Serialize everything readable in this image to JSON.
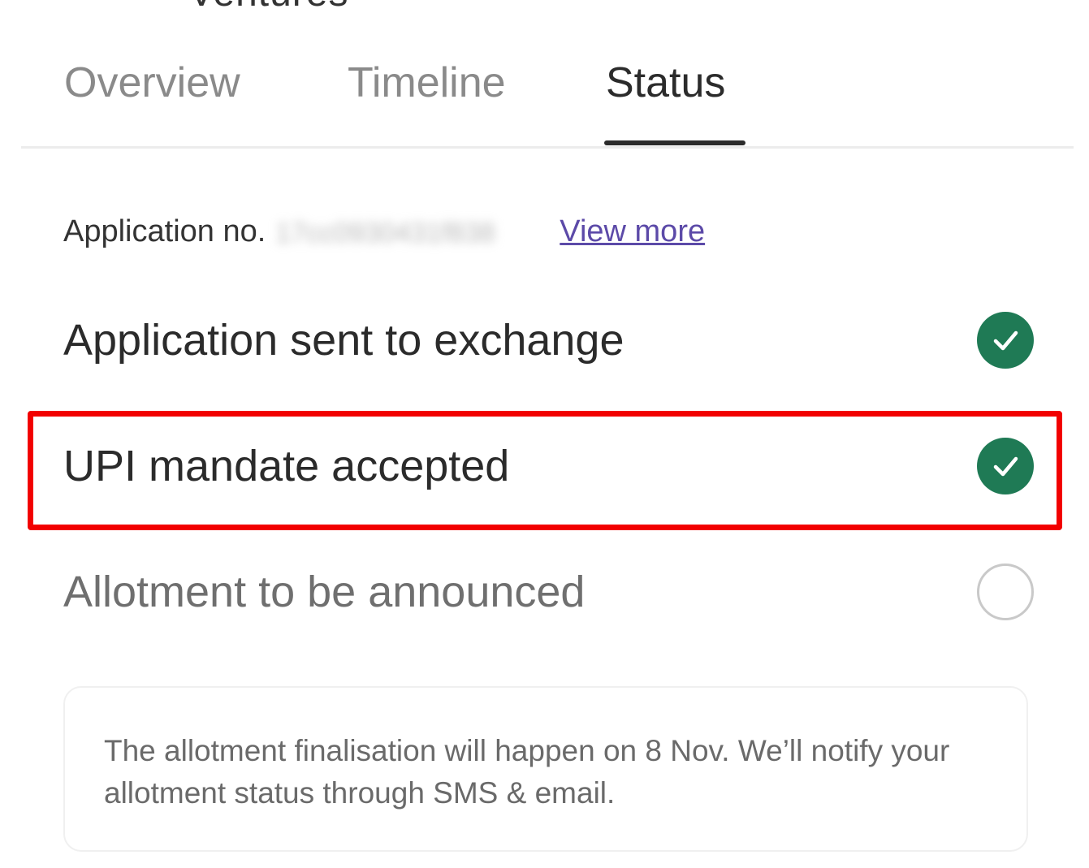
{
  "header": {
    "title_fragment": "Ventures"
  },
  "tabs": [
    {
      "label": "Overview",
      "active": false
    },
    {
      "label": "Timeline",
      "active": false
    },
    {
      "label": "Status",
      "active": true
    }
  ],
  "application": {
    "label": "Application no.",
    "number": "17cc0930431f838",
    "view_more_label": "View more"
  },
  "steps": [
    {
      "label": "Application sent to exchange",
      "status": "completed",
      "icon": "check-circle-icon"
    },
    {
      "label": "UPI mandate accepted",
      "status": "completed",
      "icon": "check-circle-icon",
      "highlighted": true
    },
    {
      "label": "Allotment to be announced",
      "status": "pending",
      "icon": "empty-circle-icon"
    }
  ],
  "info": {
    "text": "The allotment finalisation will happen on 8 Nov. We’ll notify your allotment status through SMS & email."
  },
  "colors": {
    "success": "#1f7a55",
    "highlight": "#f20000",
    "link": "#5c4aa8"
  }
}
